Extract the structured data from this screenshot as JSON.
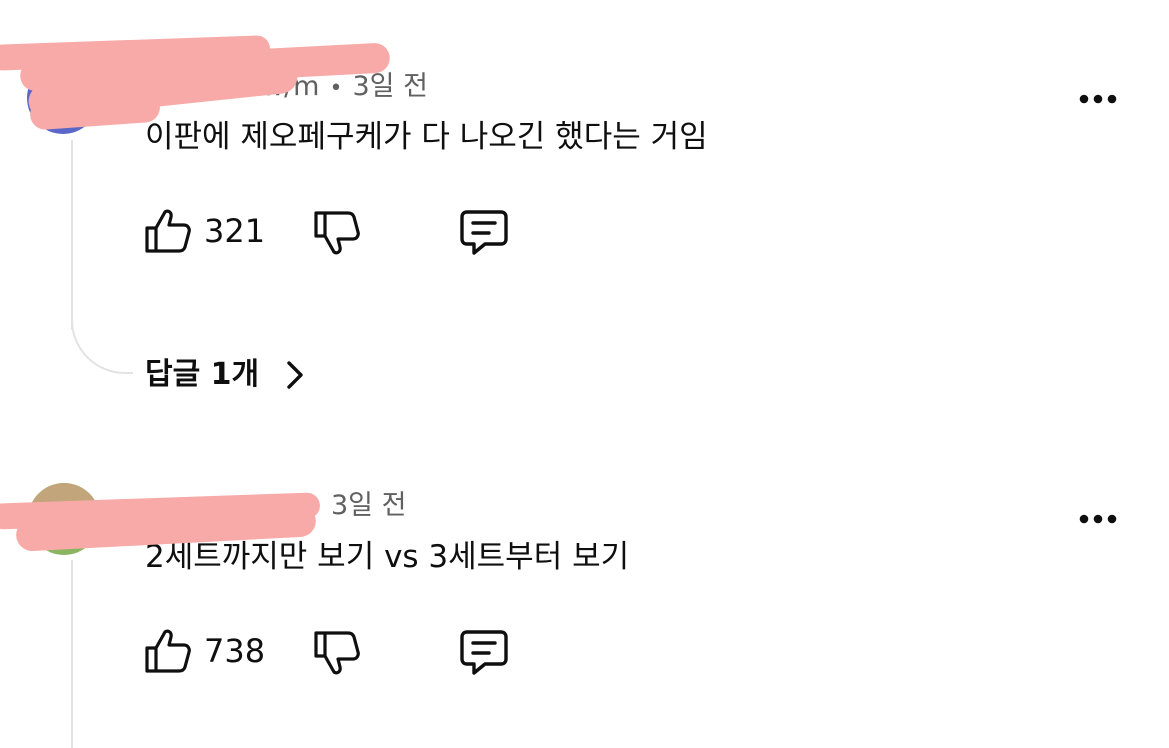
{
  "comments": [
    {
      "meta": {
        "handle_visible": "w/m",
        "time": "3일 전"
      },
      "text": "이판에 제오페구케가 다 나오긴 했다는 거임",
      "likes": "321",
      "replies_label": "답글 1개"
    },
    {
      "meta": {
        "handle_visible": "",
        "time": "3일 전"
      },
      "text": "2세트까지만 보기 vs 3세트부터 보기",
      "likes": "738"
    }
  ],
  "icons": {
    "like": "thumbs-up-icon",
    "dislike": "thumbs-down-icon",
    "reply": "comment-icon",
    "more": "more-options-icon",
    "chevron": "chevron-right-icon"
  },
  "colors": {
    "text": "#0f0f0f",
    "meta": "#606060",
    "thread": "#e3e3e3",
    "redaction": "#f7aaa8"
  }
}
